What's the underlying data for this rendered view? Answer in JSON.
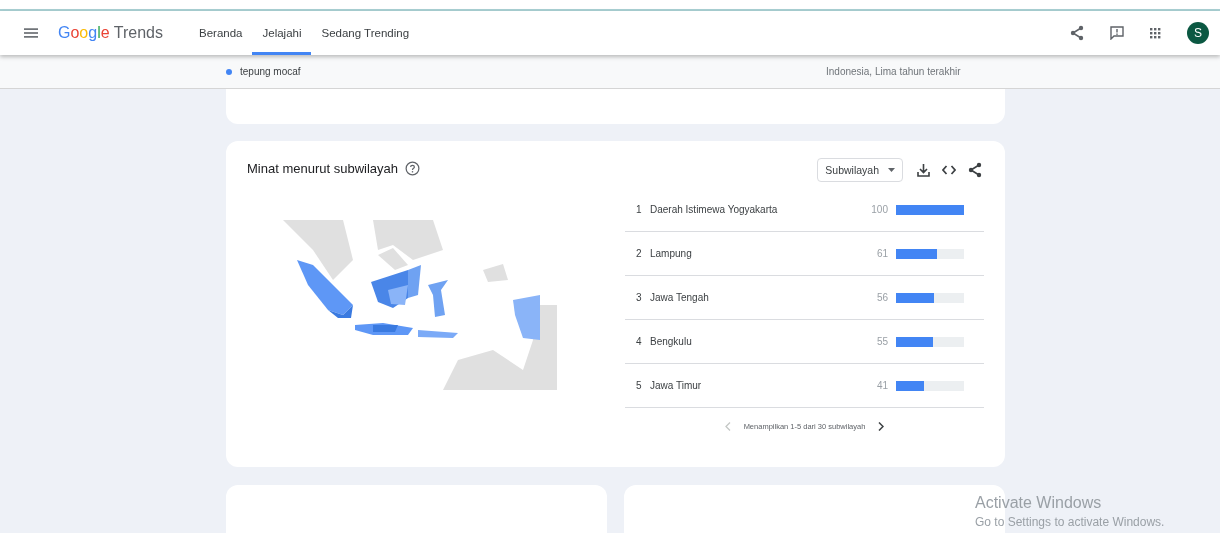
{
  "header": {
    "logo": {
      "brand": "Google",
      "product": "Trends"
    },
    "tabs": [
      {
        "label": "Beranda",
        "selected": false
      },
      {
        "label": "Jelajahi",
        "selected": true
      },
      {
        "label": "Sedang Trending",
        "selected": false
      }
    ],
    "avatar": "S"
  },
  "subheader": {
    "term": "tepung mocaf",
    "scope": "Indonesia, Lima tahun terakhir"
  },
  "panel": {
    "title": "Minat menurut subwilayah",
    "dropdown": "Subwilayah",
    "rows": [
      {
        "rank": "1",
        "name": "Daerah Istimewa Yogyakarta",
        "value": "100",
        "level": 1.0
      },
      {
        "rank": "2",
        "name": "Lampung",
        "value": "61",
        "level": 0.61
      },
      {
        "rank": "3",
        "name": "Jawa Tengah",
        "value": "56",
        "level": 0.56
      },
      {
        "rank": "4",
        "name": "Bengkulu",
        "value": "55",
        "level": 0.55
      },
      {
        "rank": "5",
        "name": "Jawa Timur",
        "value": "41",
        "level": 0.41
      }
    ],
    "pagination": "Menampilkan 1-5 dari 30 subwilayah"
  },
  "activation": {
    "title": "Activate Windows",
    "text": "Go to Settings to activate Windows."
  }
}
